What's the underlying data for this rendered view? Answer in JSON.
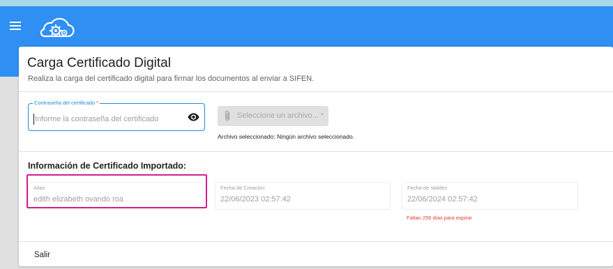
{
  "header": {
    "menu_icon": "menu-icon",
    "logo_icon": "cloud-gears-logo"
  },
  "card": {
    "title": "Carga Certificado Digital",
    "subtitle": "Realiza la carga del certificado digital para firmar los documentos al enviar a SIFEN."
  },
  "password_field": {
    "label": "Contraseña del certificado",
    "required_mark": "*",
    "placeholder": "Informe la contraseña del certificado",
    "value": "",
    "toggle_icon": "eye-icon"
  },
  "file_select": {
    "icon": "paperclip-icon",
    "label": "Seleccione un archivo...",
    "required_mark": "*",
    "status": "Archivo seleccionado: Ningún archivo seleccionado."
  },
  "imported": {
    "section_title": "Información de Certificado Importado:",
    "alias_label": "Alias",
    "alias_value": "edith elizabeth ovando roa",
    "created_label": "Fecha de Creación",
    "created_value": "22/06/2023 02:57:42",
    "valid_label": "Fecha de Validez",
    "valid_value": "22/06/2024 02:57:42",
    "expiry_note": "Faltan 256 días para expirar"
  },
  "footer": {
    "exit_label": "Salir"
  },
  "colors": {
    "app_bar": "#2f8ff2",
    "top_strip": "#a6d9ea",
    "focus": "#1e88e5",
    "highlight_box": "#d41d8c",
    "error_text": "#e53935"
  }
}
